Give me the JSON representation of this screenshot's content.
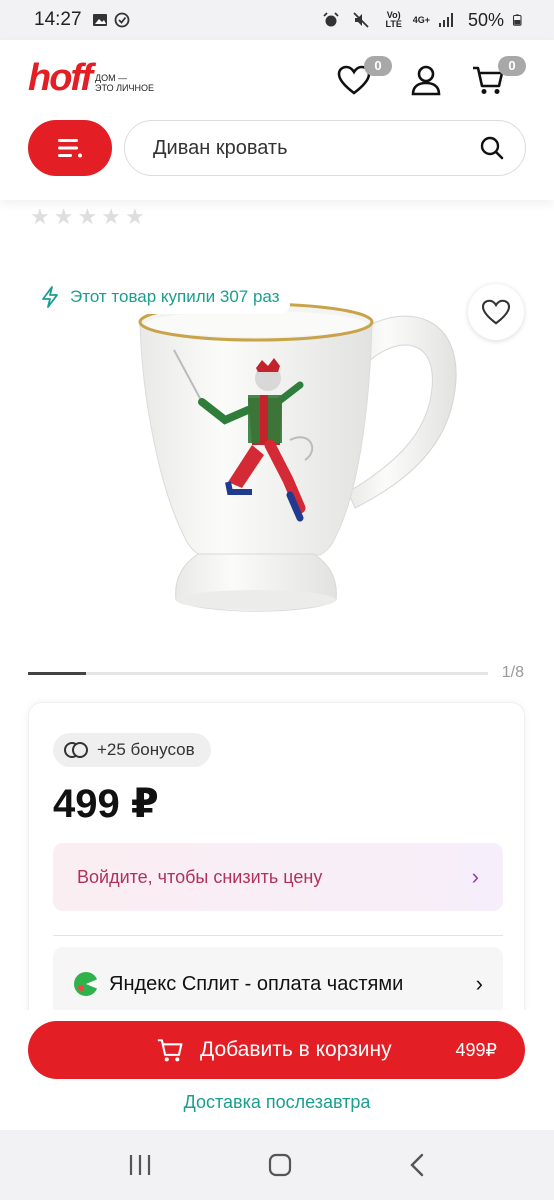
{
  "status_bar": {
    "time": "14:27",
    "battery": "50%",
    "volte": "Vo) LTE",
    "network": "4G+"
  },
  "header": {
    "logo_text": "hoff",
    "logo_tagline_1": "ДОМ —",
    "logo_tagline_2": "ЭТО ЛИЧНОЕ",
    "favorites_count": "0",
    "cart_count": "0",
    "search_value": "Диван кровать"
  },
  "product": {
    "rating_stars": 0,
    "rating_max": 5,
    "bought_text": "Этот товар купили 307 раз",
    "gallery_counter": "1/8",
    "gallery_progress": 0.125,
    "bonus_text": "+25 бонусов",
    "price": "499 ₽",
    "login_text": "Войдите, чтобы снизить цену",
    "split_text": "Яндекс Сплит - оплата частями"
  },
  "bottom": {
    "add_to_cart_label": "Добавить в корзину",
    "add_to_cart_price": "499₽",
    "delivery_text": "Доставка послезавтра"
  },
  "colors": {
    "brand_red": "#e31e24",
    "accent_teal": "#1a9e90",
    "login_text": "#b0325a"
  }
}
